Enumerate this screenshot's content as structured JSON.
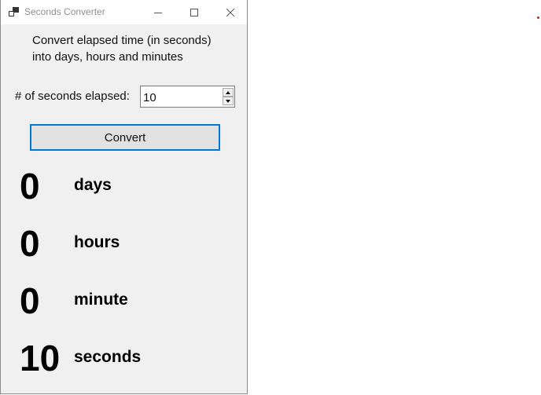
{
  "window": {
    "title": "Seconds Converter",
    "app_icon": "app-window-icon",
    "controls": {
      "minimize_icon": "minimize-icon",
      "maximize_icon": "maximize-icon",
      "close_icon": "close-icon"
    }
  },
  "intro": {
    "line1": "Convert elapsed time (in seconds)",
    "line2": "into days, hours and minutes"
  },
  "input": {
    "label": "# of seconds elapsed:",
    "value": "10"
  },
  "convert_button": {
    "label": "Convert"
  },
  "results": {
    "days": {
      "value": "0",
      "unit": "days"
    },
    "hours": {
      "value": "0",
      "unit": "hours"
    },
    "minutes": {
      "value": "0",
      "unit": "minute"
    },
    "seconds": {
      "value": "10",
      "unit": "seconds"
    }
  },
  "colors": {
    "window_bg": "#f0f0f0",
    "titlebar_bg": "#ffffff",
    "focus_border": "#0078d7",
    "button_bg": "#e1e1e1"
  }
}
